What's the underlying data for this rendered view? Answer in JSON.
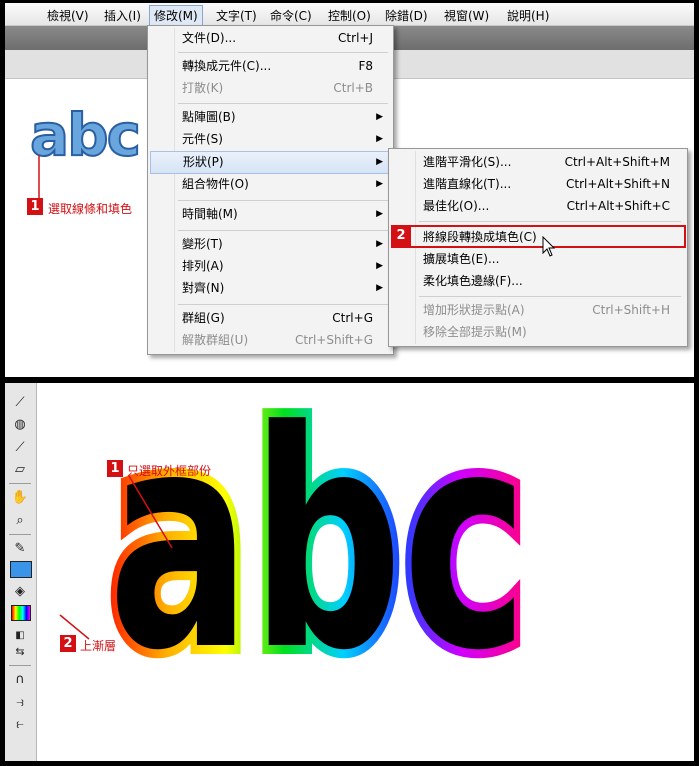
{
  "menubar": {
    "items": [
      "檢視(V)",
      "插入(I)",
      "修改(M)",
      "文字(T)",
      "命令(C)",
      "控制(O)",
      "除錯(D)",
      "視窗(W)",
      "說明(H)"
    ],
    "active": "修改(M)"
  },
  "modify_menu": {
    "doc": {
      "label": "文件(D)...",
      "shortcut": "Ctrl+J"
    },
    "convert_symbol": {
      "label": "轉換成元件(C)...",
      "shortcut": "F8"
    },
    "break_apart": {
      "label": "打散(K)",
      "shortcut": "Ctrl+B"
    },
    "bitmap": {
      "label": "點陣圖(B)"
    },
    "symbol": {
      "label": "元件(S)"
    },
    "shape": {
      "label": "形狀(P)"
    },
    "combine": {
      "label": "組合物件(O)"
    },
    "timeline": {
      "label": "時間軸(M)"
    },
    "transform": {
      "label": "變形(T)"
    },
    "arrange": {
      "label": "排列(A)"
    },
    "align": {
      "label": "對齊(N)"
    },
    "group": {
      "label": "群組(G)",
      "shortcut": "Ctrl+G"
    },
    "ungroup": {
      "label": "解散群組(U)",
      "shortcut": "Ctrl+Shift+G"
    }
  },
  "shape_menu": {
    "smooth": {
      "label": "進階平滑化(S)...",
      "shortcut": "Ctrl+Alt+Shift+M"
    },
    "straighten": {
      "label": "進階直線化(T)...",
      "shortcut": "Ctrl+Alt+Shift+N"
    },
    "optimize": {
      "label": "最佳化(O)...",
      "shortcut": "Ctrl+Alt+Shift+C"
    },
    "lines_to_fills": {
      "label": "將線段轉換成填色(C)"
    },
    "expand_fill": {
      "label": "擴展填色(E)..."
    },
    "soften_edges": {
      "label": "柔化填色邊緣(F)..."
    },
    "add_hint": {
      "label": "增加形狀提示點(A)",
      "shortcut": "Ctrl+Shift+H"
    },
    "remove_hints": {
      "label": "移除全部提示點(M)"
    }
  },
  "top_panel": {
    "sample_text": "abc",
    "step1_badge": "1",
    "step1_text": "選取線條和填色",
    "step2_badge": "2"
  },
  "bottom_panel": {
    "sample_text": "abc",
    "step1_badge": "1",
    "step1_text": "只選取外框部份",
    "step2_badge": "2",
    "step2_text": "上漸層"
  },
  "colors": {
    "callout_red": "#d31014",
    "stroke_blue": "#2a5fa2",
    "fill_blue": "#6aa6de",
    "tool_fill_swatch": "#3a95e8"
  },
  "icons": [
    "bone-tool-icon",
    "paint-bucket-icon",
    "eyedropper-icon",
    "eraser-icon",
    "hand-icon",
    "zoom-icon",
    "pencil-stroke-icon",
    "fill-color-swatch-icon",
    "bucket-fill-icon",
    "rainbow-gradient-icon",
    "swap-colors-icon",
    "default-colors-icon",
    "snap-magnet-icon",
    "smooth-icon",
    "straighten-icon",
    "chevron-right-icon",
    "mouse-cursor-icon"
  ]
}
